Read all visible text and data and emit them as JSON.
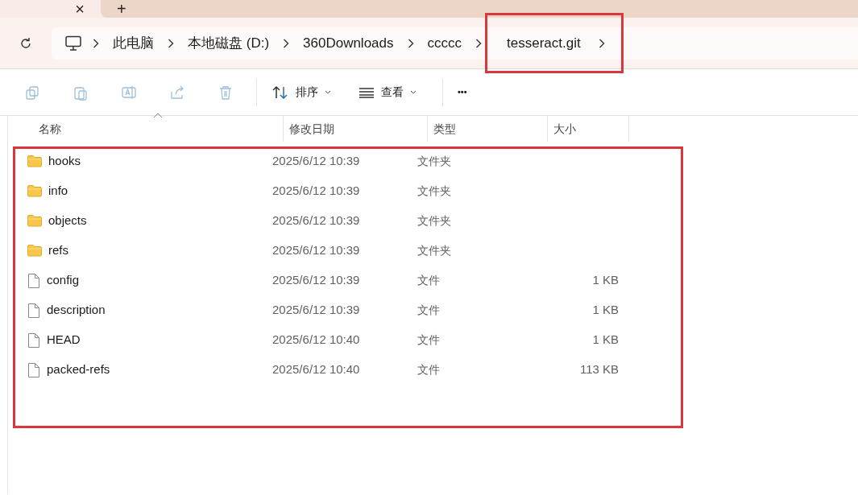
{
  "tab_strip": {
    "close_glyph": "×",
    "new_tab_glyph": "+"
  },
  "breadcrumb": [
    {
      "label": "此电脑",
      "highlighted": false
    },
    {
      "label": "本地磁盘 (D:)",
      "highlighted": false
    },
    {
      "label": "360Downloads",
      "highlighted": false
    },
    {
      "label": "ccccc",
      "highlighted": false
    },
    {
      "label": "tesseract.git",
      "highlighted": true
    }
  ],
  "toolbar": {
    "buttons": [
      {
        "kind": "copy",
        "disabled": true
      },
      {
        "kind": "paste",
        "disabled": true
      },
      {
        "kind": "rename",
        "disabled": true
      },
      {
        "kind": "share",
        "disabled": true
      },
      {
        "kind": "delete",
        "disabled": true
      }
    ],
    "sort_label": "排序",
    "view_label": "查看",
    "more_glyph": "•••"
  },
  "table": {
    "columns": [
      "名称",
      "修改日期",
      "类型",
      "大小"
    ],
    "highlighted": true,
    "rows": [
      {
        "kind": "folder",
        "name": "hooks",
        "modified": "2025/6/12 10:39",
        "type": "文件夹"
      },
      {
        "kind": "folder",
        "name": "info",
        "modified": "2025/6/12 10:39",
        "type": "文件夹"
      },
      {
        "kind": "folder",
        "name": "objects",
        "modified": "2025/6/12 10:39",
        "type": "文件夹"
      },
      {
        "kind": "folder",
        "name": "refs",
        "modified": "2025/6/12 10:39",
        "type": "文件夹"
      },
      {
        "kind": "file",
        "name": "config",
        "modified": "2025/6/12 10:39",
        "type": "文件",
        "size": "1 KB"
      },
      {
        "kind": "file",
        "name": "description",
        "modified": "2025/6/12 10:39",
        "type": "文件",
        "size": "1 KB"
      },
      {
        "kind": "file",
        "name": "HEAD",
        "modified": "2025/6/12 10:40",
        "type": "文件",
        "size": "1 KB"
      },
      {
        "kind": "file",
        "name": "packed-refs",
        "modified": "2025/6/12 10:40",
        "type": "文件",
        "size": "113 KB"
      }
    ]
  }
}
